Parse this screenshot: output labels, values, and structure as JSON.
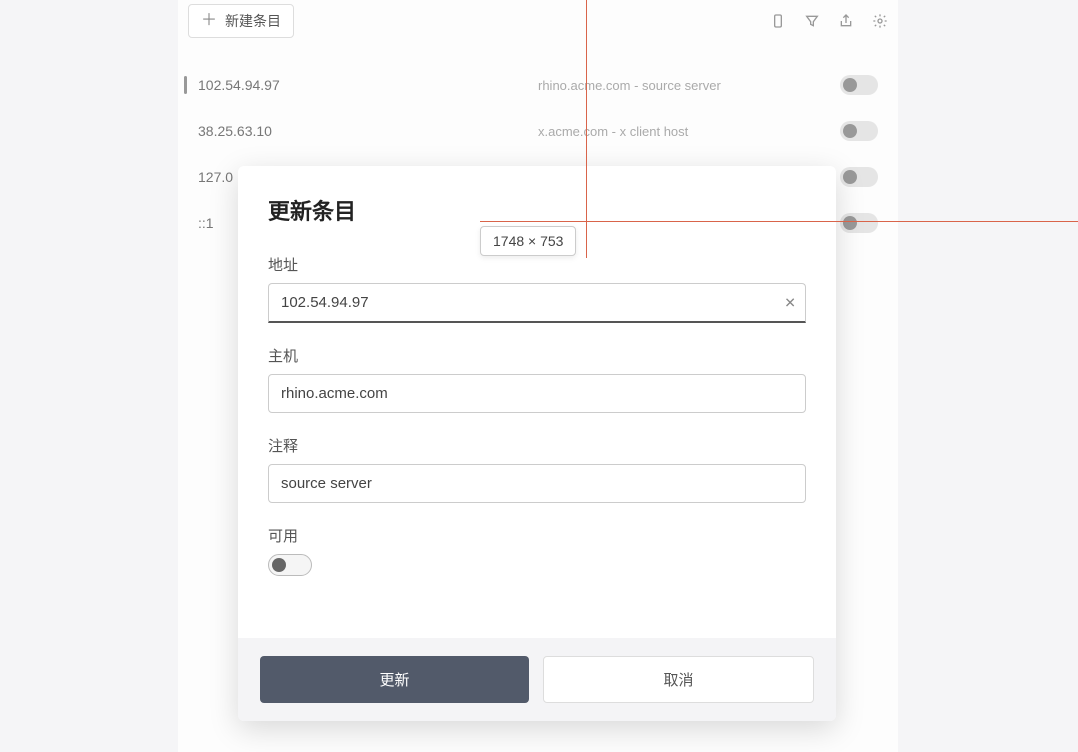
{
  "toolbar": {
    "new_entry_label": "新建条目"
  },
  "entries": [
    {
      "ip": "102.54.94.97",
      "host": "rhino.acme.com - source server"
    },
    {
      "ip": "38.25.63.10",
      "host": "x.acme.com - x client host"
    },
    {
      "ip": "127.0",
      "host": ""
    },
    {
      "ip": "::1",
      "host": ""
    }
  ],
  "modal": {
    "title": "更新条目",
    "address_label": "地址",
    "address_value": "102.54.94.97",
    "host_label": "主机",
    "host_value": "rhino.acme.com",
    "comment_label": "注释",
    "comment_value": "source server",
    "enabled_label": "可用",
    "update_btn": "更新",
    "cancel_btn": "取消"
  },
  "dimension_badge": "1748 × 753"
}
